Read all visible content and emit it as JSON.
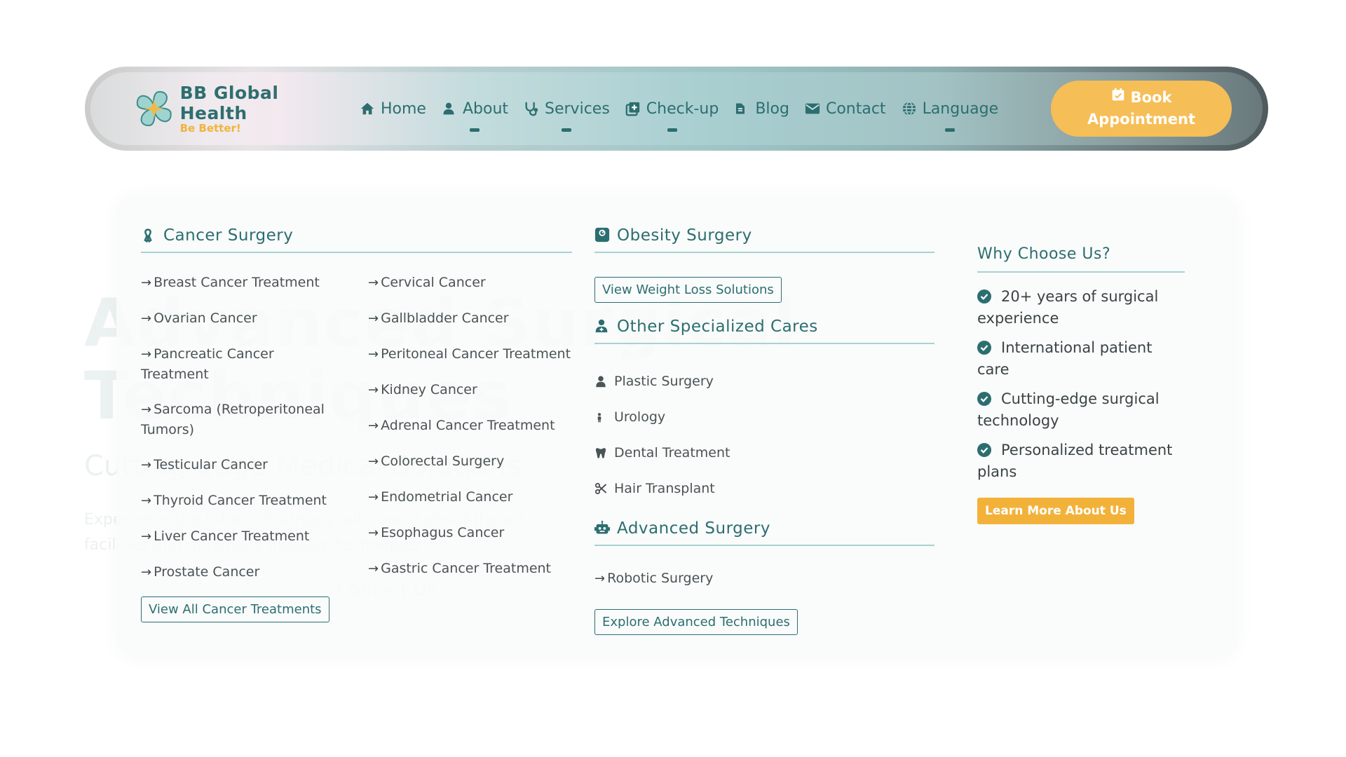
{
  "brand": {
    "name": "BB Global Health",
    "tagline": "Be Better!"
  },
  "nav": {
    "items": [
      {
        "label": "Home",
        "icon": "home-icon"
      },
      {
        "label": "About",
        "icon": "user-icon"
      },
      {
        "label": "Services",
        "icon": "stethoscope-icon"
      },
      {
        "label": "Check-up",
        "icon": "medical-kit-icon"
      },
      {
        "label": "Blog",
        "icon": "document-icon"
      },
      {
        "label": "Contact",
        "icon": "envelope-icon"
      },
      {
        "label": "Language",
        "icon": "globe-icon"
      }
    ],
    "book_button": {
      "line1": "Book",
      "line2": "Appointment",
      "icon": "calendar-check-icon"
    }
  },
  "hero_background": {
    "title_line1": "Advanced Surgical",
    "title_line2": "Techniques",
    "subtitle": "Cutting-edge Medical Solutions",
    "text_line1": "Experience the future of surgery with our state-of-the-art",
    "text_line2": "facilities and minimally invasive techniques",
    "contact_button": "Contact Us"
  },
  "cancer_surgery": {
    "heading": "Cancer Surgery",
    "icon": "ribbon-icon",
    "left": [
      "Breast Cancer Treatment",
      "Ovarian Cancer",
      "Pancreatic Cancer Treatment",
      "Sarcoma (Retroperitoneal Tumors)",
      "Testicular Cancer",
      "Thyroid Cancer Treatment",
      "Liver Cancer Treatment",
      "Prostate Cancer"
    ],
    "right": [
      "Cervical Cancer",
      "Gallbladder Cancer",
      "Peritoneal Cancer Treatment",
      "Kidney Cancer",
      "Adrenal Cancer Treatment",
      "Colorectal Surgery",
      "Endometrial Cancer",
      "Esophagus Cancer",
      "Gastric Cancer Treatment"
    ],
    "view_all": "View All Cancer Treatments"
  },
  "obesity_surgery": {
    "heading": "Obesity Surgery",
    "icon": "weight-scale-icon",
    "button": "View Weight Loss Solutions"
  },
  "specialized": {
    "heading": "Other Specialized Cares",
    "icon": "doctor-icon",
    "items": [
      {
        "label": "Plastic Surgery",
        "icon": "user-doctor-icon"
      },
      {
        "label": "Urology",
        "icon": "person-icon"
      },
      {
        "label": "Dental Treatment",
        "icon": "tooth-icon"
      },
      {
        "label": "Hair Transplant",
        "icon": "scissors-icon"
      }
    ]
  },
  "advanced_surgery": {
    "heading": "Advanced Surgery",
    "icon": "robot-icon",
    "items": [
      "Robotic Surgery"
    ],
    "button": "Explore Advanced Techniques"
  },
  "why_choose": {
    "heading": "Why Choose Us?",
    "items": [
      {
        "line1": "20+ years of surgical",
        "line2": "experience"
      },
      {
        "line1": "International patient",
        "line2": "care"
      },
      {
        "line1": "Cutting-edge surgical",
        "line2": "technology"
      },
      {
        "line1": "Personalized treatment",
        "line2": "plans"
      }
    ],
    "button": "Learn More About Us"
  },
  "colors": {
    "primary": "#2c6e70",
    "accent": "#f6be57",
    "divider": "#a7d2d2"
  }
}
